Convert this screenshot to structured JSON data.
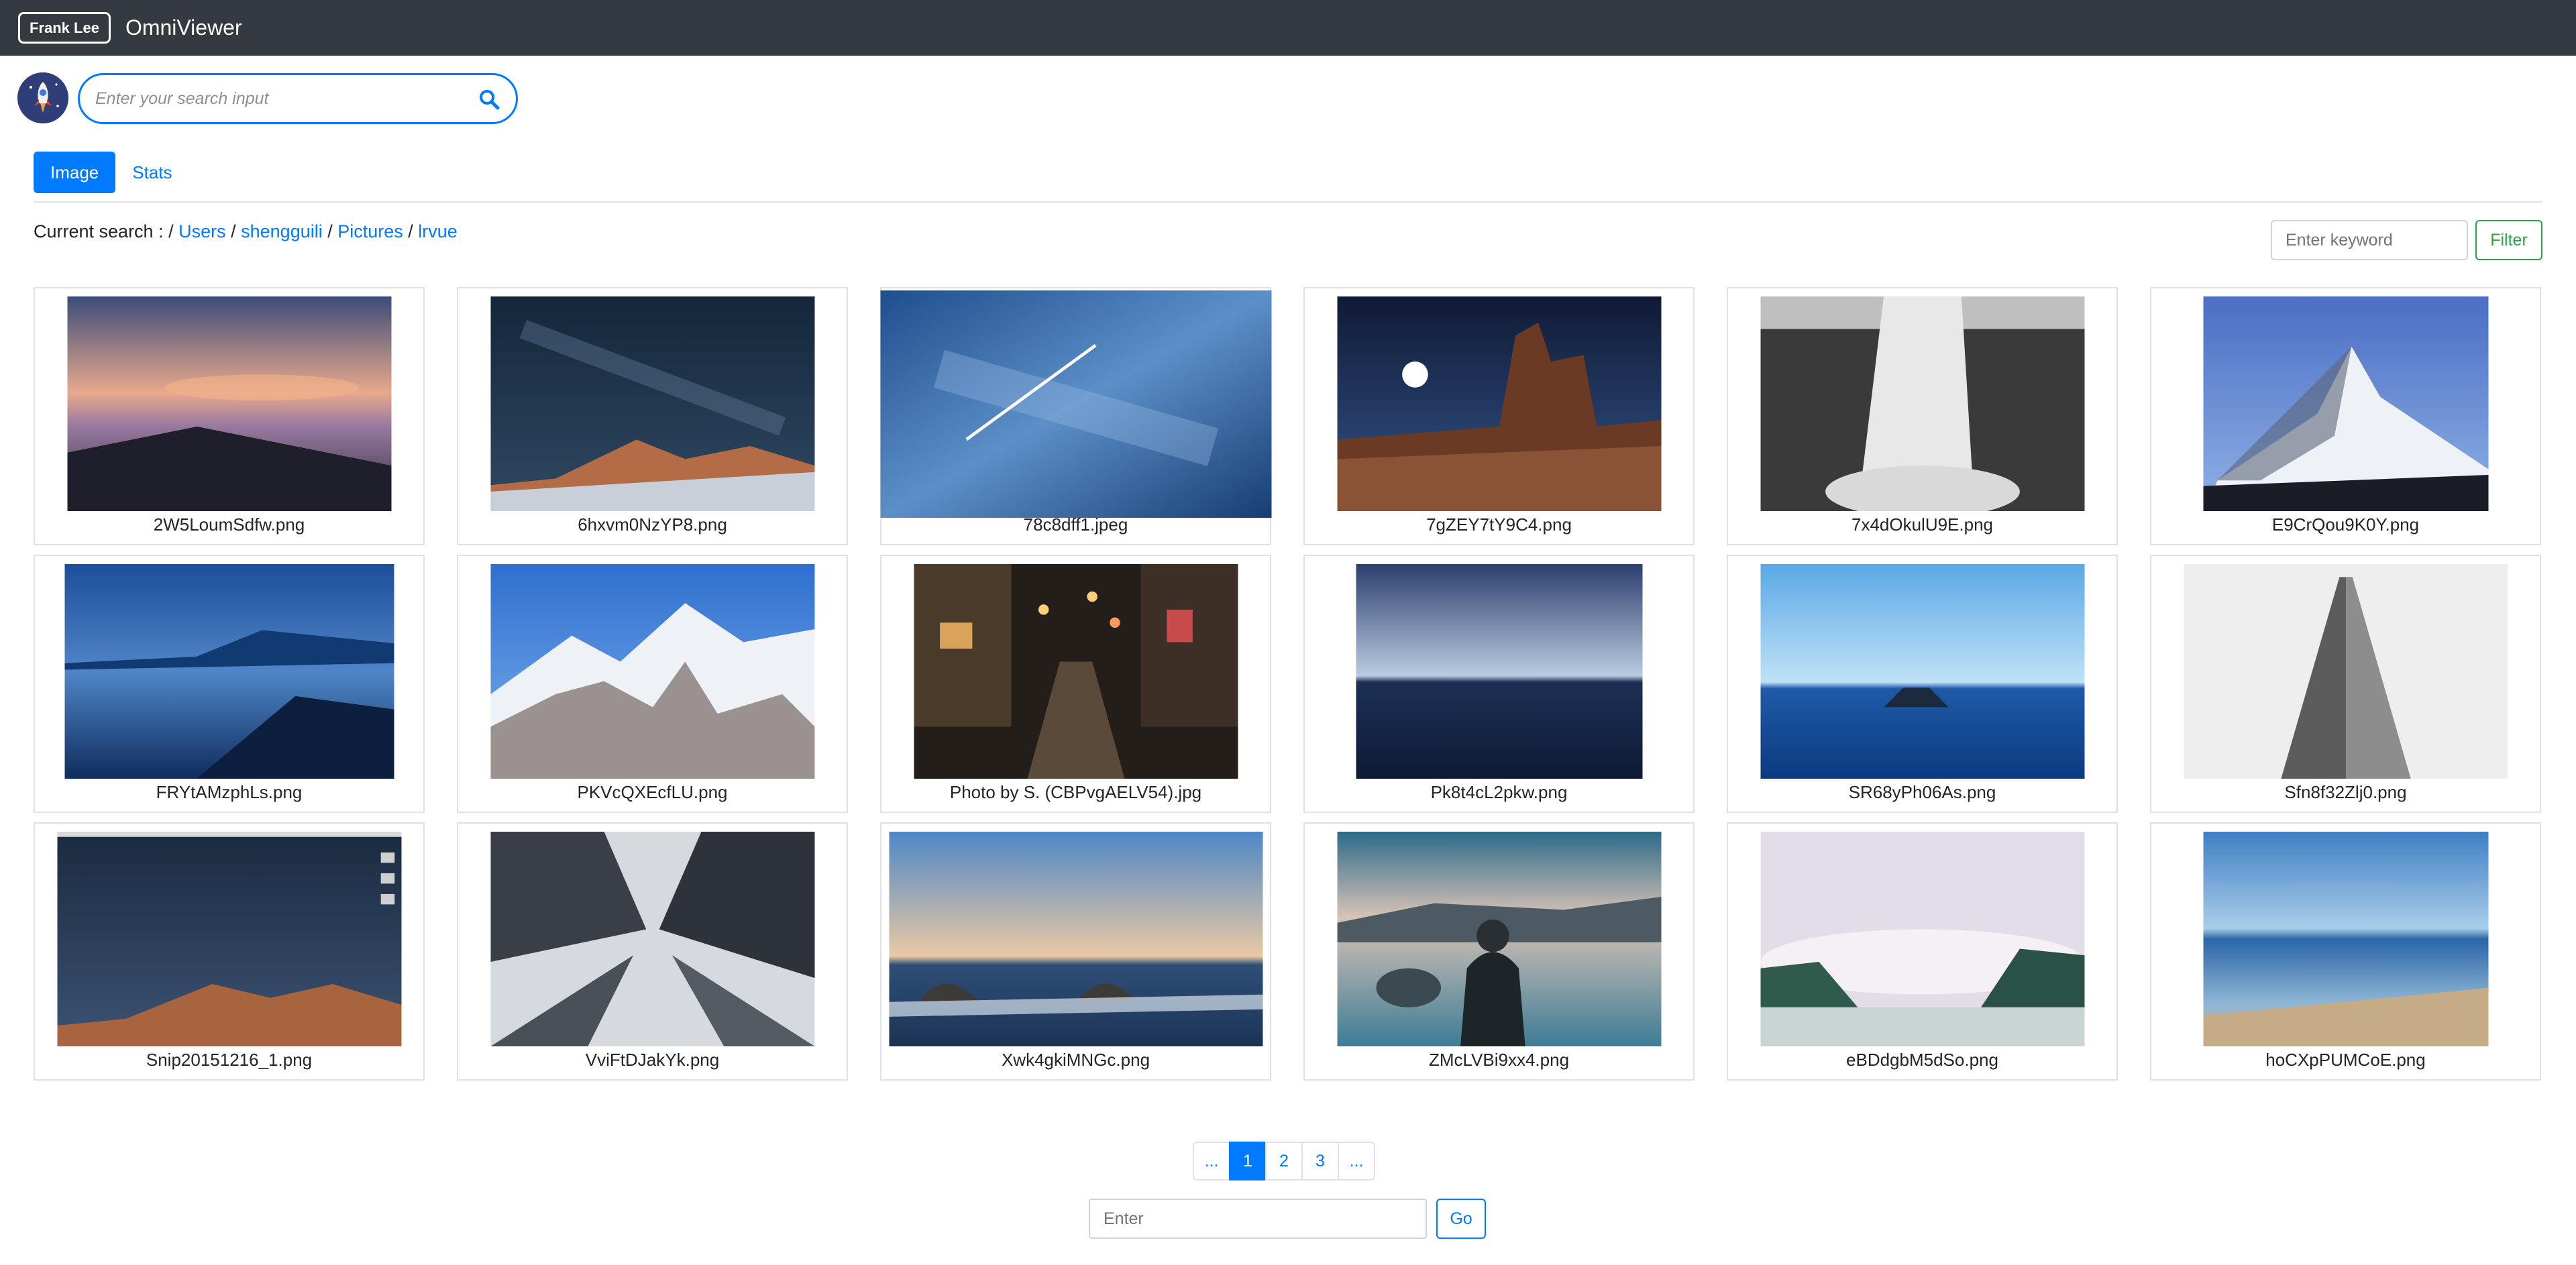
{
  "navbar": {
    "user_badge": "Frank Lee",
    "brand": "OmniViewer"
  },
  "search": {
    "placeholder": "Enter your search input",
    "value": ""
  },
  "tabs": [
    {
      "label": "Image",
      "active": true
    },
    {
      "label": "Stats",
      "active": false
    }
  ],
  "breadcrumb": {
    "prefix": "Current search : / ",
    "parts": [
      "Users",
      "shengguili",
      "Pictures",
      "lrvue"
    ],
    "separator": " / "
  },
  "filter": {
    "placeholder": "Enter keyword",
    "button_label": "Filter"
  },
  "gallery": [
    {
      "filename": "2W5LoumSdfw.png"
    },
    {
      "filename": "6hxvm0NzYP8.png"
    },
    {
      "filename": "78c8dff1.jpeg"
    },
    {
      "filename": "7gZEY7tY9C4.png"
    },
    {
      "filename": "7x4dOkulU9E.png"
    },
    {
      "filename": "E9CrQou9K0Y.png"
    },
    {
      "filename": "FRYtAMzphLs.png"
    },
    {
      "filename": "PKVcQXEcfLU.png"
    },
    {
      "filename": "Photo by S. (CBPvgAELV54).jpg"
    },
    {
      "filename": "Pk8t4cL2pkw.png"
    },
    {
      "filename": "SR68yPh06As.png"
    },
    {
      "filename": "Sfn8f32Zlj0.png"
    },
    {
      "filename": "Snip20151216_1.png"
    },
    {
      "filename": "VviFtDJakYk.png"
    },
    {
      "filename": "Xwk4gkiMNGc.png"
    },
    {
      "filename": "ZMcLVBi9xx4.png"
    },
    {
      "filename": "eBDdgbM5dSo.png"
    },
    {
      "filename": "hoCXpPUMCoE.png"
    }
  ],
  "pagination": {
    "pages": [
      "...",
      "1",
      "2",
      "3",
      "..."
    ],
    "current": "1",
    "goto_placeholder": "Enter",
    "goto_button": "Go"
  },
  "colors": {
    "navbar": "#343a40",
    "accent": "#007bff",
    "filter": "#28a745"
  }
}
